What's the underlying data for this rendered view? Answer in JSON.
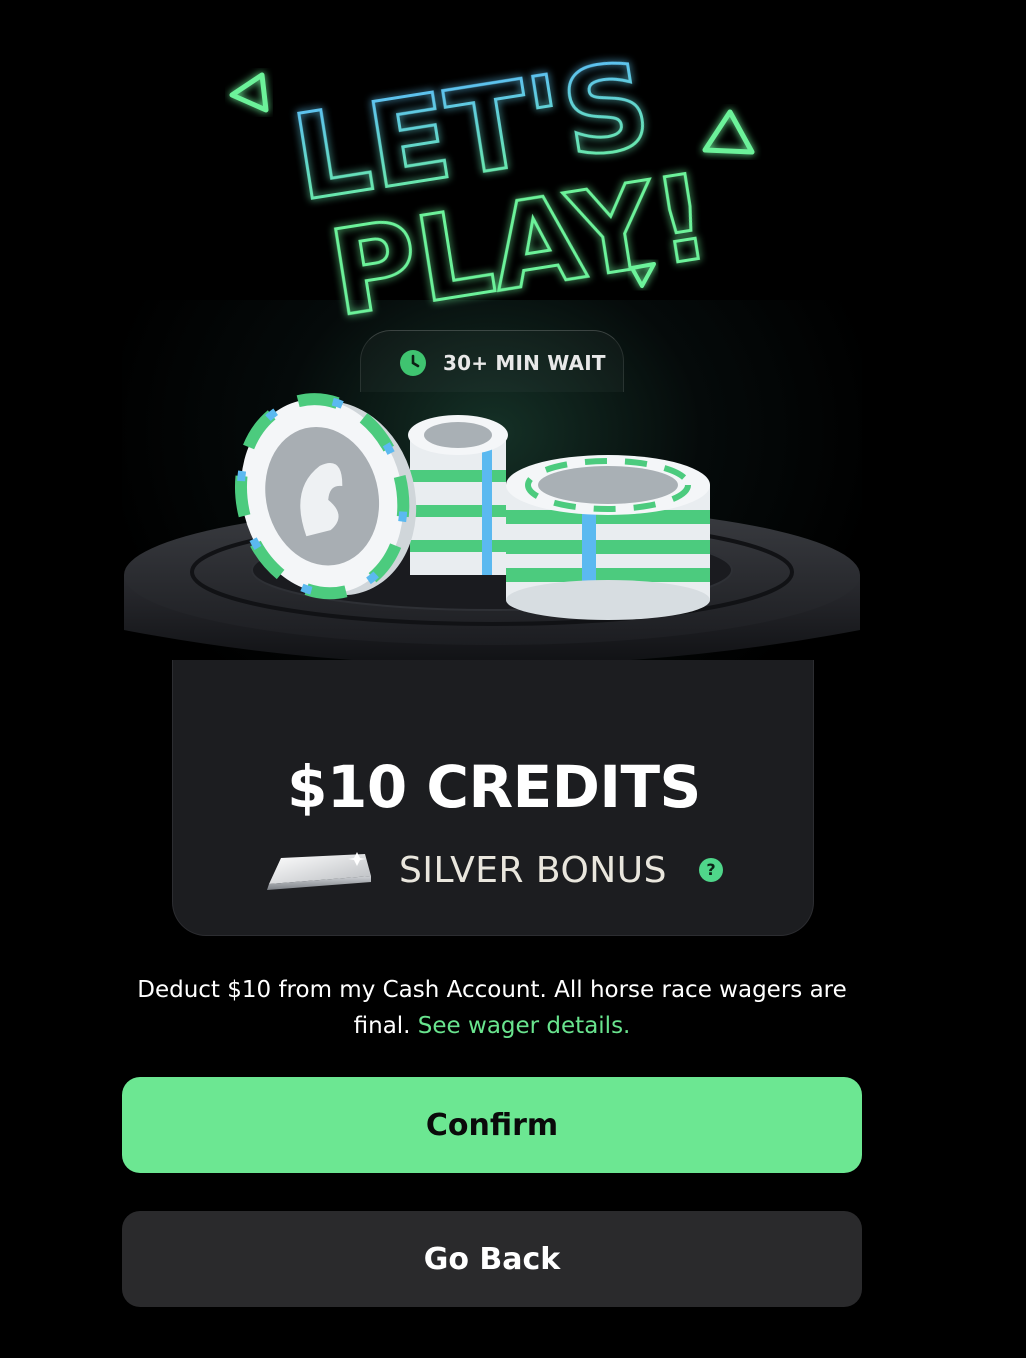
{
  "hero": {
    "headline_line1": "LET'S",
    "headline_line2": "PLAY!",
    "wait_badge": {
      "icon": "clock-icon",
      "label": "30+ MIN WAIT"
    }
  },
  "prize": {
    "amount_label": "$10 CREDITS",
    "bonus_label": "SILVER BONUS",
    "bonus_icon": "silver-bar-icon",
    "help_icon": "question-icon",
    "help_glyph": "?"
  },
  "disclaimer": {
    "text": "Deduct $10 from my Cash Account. All horse race wagers are final. ",
    "link_label": "See wager details."
  },
  "actions": {
    "confirm_label": "Confirm",
    "back_label": "Go Back"
  },
  "colors": {
    "background": "#000000",
    "accent_green": "#6ce792",
    "link_green": "#69e48e",
    "neon_blue": "#5ab8ff",
    "neon_green": "#6cf29a",
    "card_background": "#1c1d20",
    "secondary_button": "#2a2a2c"
  }
}
